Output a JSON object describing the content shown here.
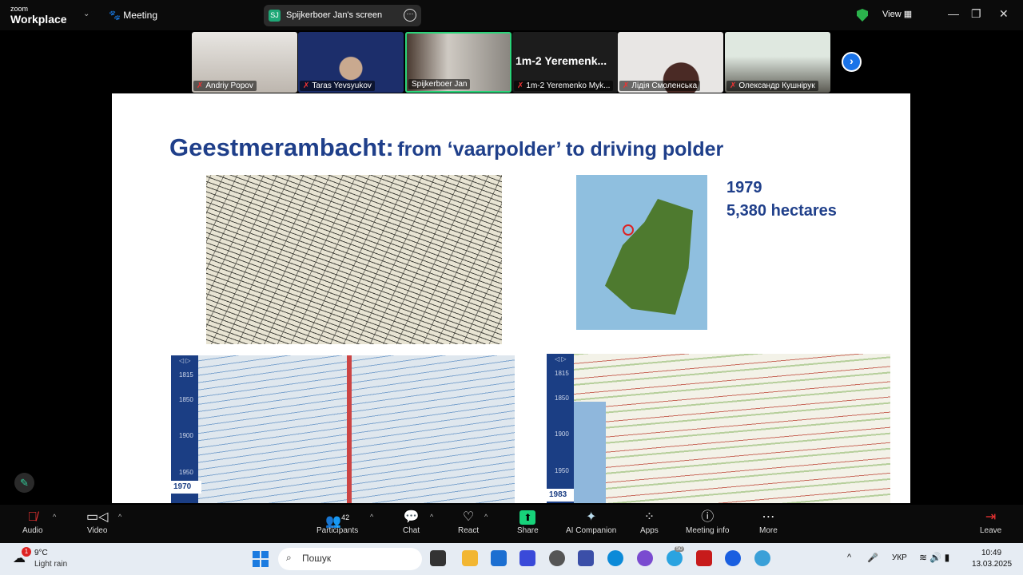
{
  "app": {
    "logo_small": "zoom",
    "logo_big": "Workplace",
    "meeting_label": "Meeting",
    "share_initials": "SJ",
    "share_label": "Spijkerboer Jan's screen",
    "view_label": "View"
  },
  "participants": [
    {
      "name": "Andriy Popov",
      "muted": true
    },
    {
      "name": "Taras Yevsyukov",
      "muted": true
    },
    {
      "name": "Spijkerboer Jan",
      "muted": false,
      "active": true
    },
    {
      "name": "1m-2 Yeremenko Myk...",
      "display": "1m-2  Yeremenk...",
      "muted": true
    },
    {
      "name": "Лідія Смоленська",
      "muted": true
    },
    {
      "name": "Олександр Кушнірук",
      "muted": true
    }
  ],
  "slide": {
    "title_main": "Geestmerambacht:",
    "title_sub": "from ‘vaarpolder’ to driving polder",
    "year": "1979",
    "area": "5,380 hectares",
    "timeline_ticks": [
      "1815",
      "1850",
      "1900",
      "1950"
    ],
    "map1_year": "1970",
    "map2_year": "1983"
  },
  "toolbar": {
    "audio": "Audio",
    "video": "Video",
    "participants": "Participants",
    "participant_count": "42",
    "chat": "Chat",
    "react": "React",
    "share": "Share",
    "ai": "AI Companion",
    "apps": "Apps",
    "info": "Meeting info",
    "more": "More",
    "leave": "Leave"
  },
  "taskbar": {
    "weather_badge": "1",
    "temp": "9°C",
    "weather": "Light rain",
    "search_placeholder": "Пошук",
    "lang": "УКР",
    "time": "10:49",
    "date": "13.03.2025",
    "telegram_badge": "50"
  },
  "colors": {
    "accent": "#1f3f8a",
    "share_green": "#17d27a",
    "active_border": "#2bd47a"
  }
}
